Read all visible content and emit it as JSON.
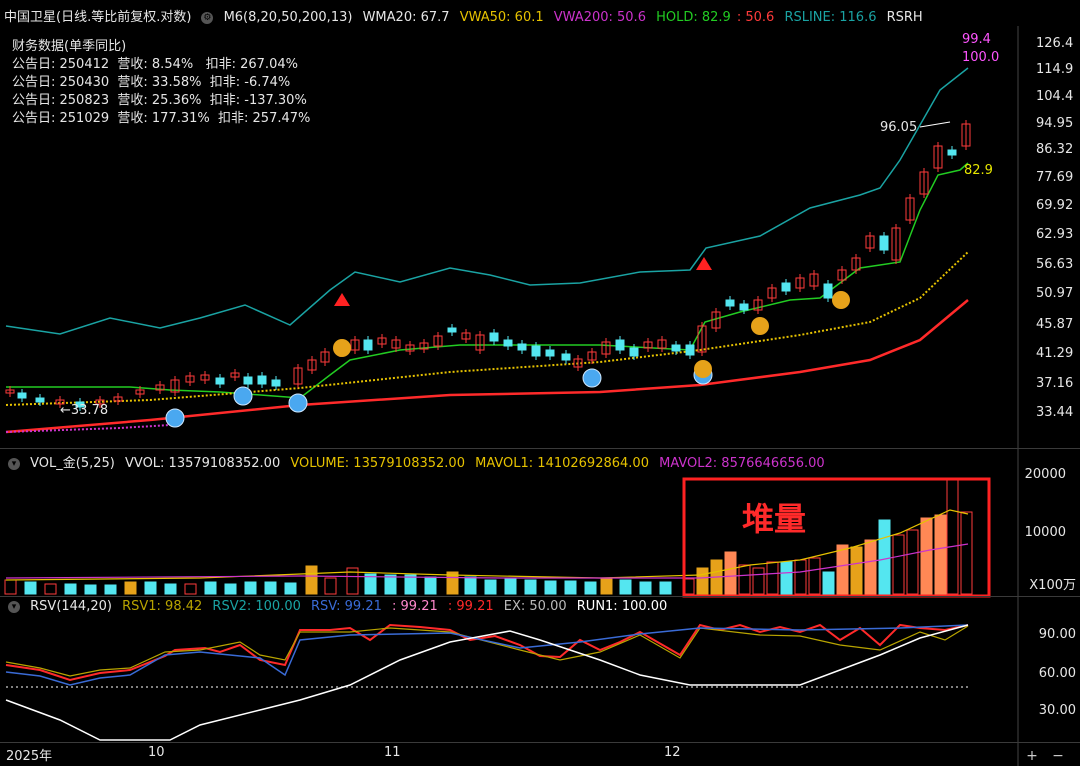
{
  "header_main": {
    "title": "中国卫星(日线.等比前复权.对数)",
    "m6": "M6(8,20,50,200,13)",
    "wma20": "WMA20: 67.7",
    "vwa50": "VWA50: 60.1",
    "vwa200": "VWA200: 50.6",
    "hold": "HOLD: 82.9",
    "hold2": ": 50.6",
    "rsline": "RSLINE: 116.6",
    "rsrh": "RSRH"
  },
  "finance": {
    "title": "财务数据(单季同比)",
    "rows": [
      "公告日: 250412  营收: 8.54%   扣非: 267.04%",
      "公告日: 250430  营收: 33.58%  扣非: -6.74%",
      "公告日: 250823  营收: 25.36%  扣非: -137.30%",
      "公告日: 251029  营收: 177.31%  扣非: 257.47%"
    ]
  },
  "price_axis": [
    "126.4",
    "114.9",
    "104.4",
    "94.95",
    "86.32",
    "77.69",
    "69.92",
    "62.93",
    "56.63",
    "50.97",
    "45.87",
    "41.29",
    "37.16",
    "33.44"
  ],
  "price_annotations": {
    "low": "←33.78",
    "high": "96.05",
    "rs_top": "99.4",
    "rs_top2": "100.0",
    "hold_val": "82.9"
  },
  "header_vol": {
    "name": "VOL_金(5,25)",
    "vvol": "VVOL: 13579108352.00",
    "volume": "VOLUME: 13579108352.00",
    "mavol1": "MAVOL1: 14102692864.00",
    "mavol2": "MAVOL2: 8576646656.00"
  },
  "vol_axis": [
    "20000",
    "10000",
    "X100万"
  ],
  "vol_annotation": "堆量",
  "header_rsv": {
    "name": "RSV(144,20)",
    "rsv1": "RSV1: 98.42",
    "rsv2": "RSV2: 100.00",
    "rsv": "RSV: 99.21",
    "v1": ": 99.21",
    "v2": ": 99.21",
    "ex": "EX: 50.00",
    "run1": "RUN1: 100.00"
  },
  "rsv_axis": [
    "90.00",
    "60.00",
    "30.00"
  ],
  "x_axis": [
    "2025年",
    "10",
    "11",
    "12"
  ],
  "corner": {
    "plus": "+",
    "minus": "−"
  },
  "colors": {
    "up": "#ff3b3b",
    "down": "#54e6f0",
    "hold": "#22cc22",
    "rsline": "#1aa3a3",
    "vwa50": "#e6c200",
    "vwa200": "#cc33cc",
    "ma": "#ff2a2a"
  }
}
